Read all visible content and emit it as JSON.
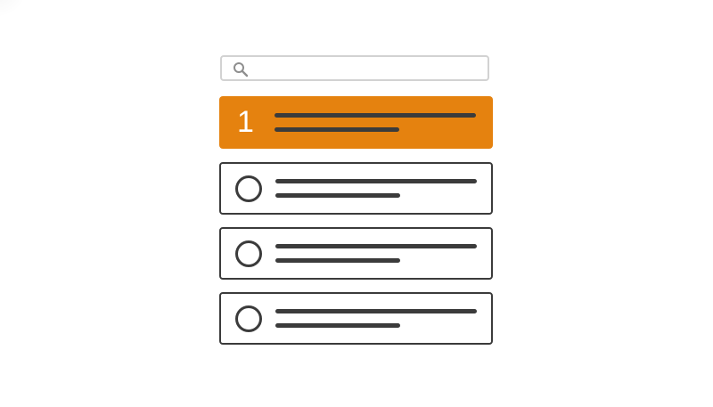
{
  "search": {
    "icon": "search-icon",
    "text": ""
  },
  "results": [
    {
      "marker": "1",
      "selected": true
    },
    {
      "marker": "",
      "selected": false
    },
    {
      "marker": "",
      "selected": false
    },
    {
      "marker": "",
      "selected": false
    }
  ],
  "colors": {
    "accent": "#e5820f",
    "ink": "#3b3b3b",
    "search_border": "#d2d2d2",
    "background": "#ffffff"
  }
}
